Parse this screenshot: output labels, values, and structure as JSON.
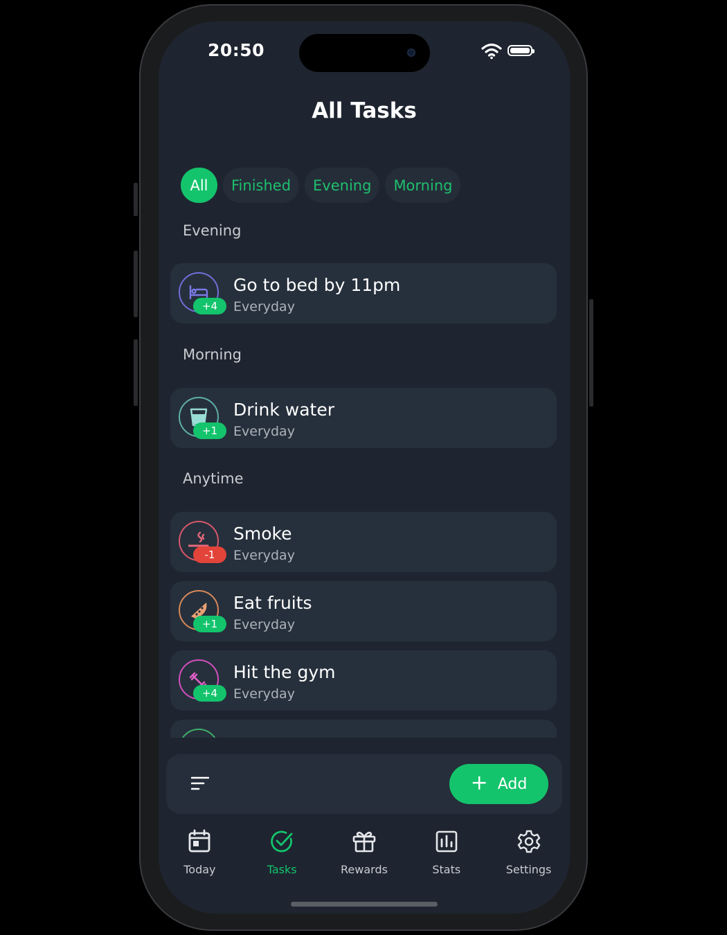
{
  "status_bar": {
    "time": "20:50"
  },
  "header": {
    "title": "All Tasks"
  },
  "filters": [
    {
      "label": "All",
      "active": true
    },
    {
      "label": "Finished",
      "active": false
    },
    {
      "label": "Evening",
      "active": false
    },
    {
      "label": "Morning",
      "active": false
    }
  ],
  "sections": [
    {
      "title": "Evening"
    },
    {
      "title": "Morning"
    },
    {
      "title": "Anytime"
    }
  ],
  "tasks": [
    {
      "name": "Go to bed by 11pm",
      "frequency": "Everyday",
      "points": "+4",
      "icon": "bed-icon",
      "color": "#6f6fd8"
    },
    {
      "name": "Drink water",
      "frequency": "Everyday",
      "points": "+1",
      "icon": "glass-icon",
      "color": "#5fb0a8"
    },
    {
      "name": "Smoke",
      "frequency": "Everyday",
      "points": "-1",
      "icon": "cigarette-icon",
      "color": "#d9576a"
    },
    {
      "name": "Eat fruits",
      "frequency": "Everyday",
      "points": "+1",
      "icon": "watermelon-icon",
      "color": "#d98a5a"
    },
    {
      "name": "Hit the gym",
      "frequency": "Everyday",
      "points": "+4",
      "icon": "dumbbell-icon",
      "color": "#d34fbe"
    }
  ],
  "toolbar": {
    "add_label": "Add"
  },
  "nav": [
    {
      "label": "Today",
      "icon": "calendar-icon"
    },
    {
      "label": "Tasks",
      "icon": "check-circle-icon",
      "active": true
    },
    {
      "label": "Rewards",
      "icon": "gift-icon"
    },
    {
      "label": "Stats",
      "icon": "chart-icon"
    },
    {
      "label": "Settings",
      "icon": "gear-icon"
    }
  ],
  "colors": {
    "accent": "#13c46c",
    "negative": "#e2443a",
    "background": "#1e2530",
    "card": "#26303c"
  }
}
